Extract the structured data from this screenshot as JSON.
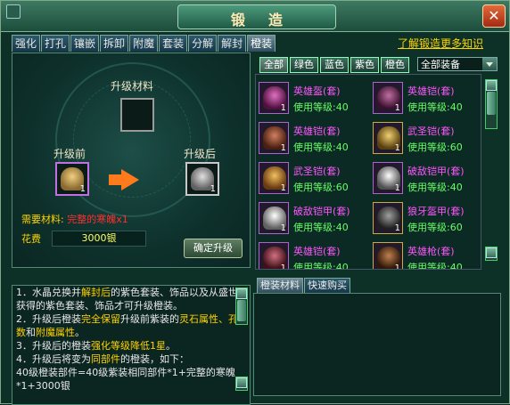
{
  "window": {
    "title": "锻造",
    "close_glyph": "✕"
  },
  "tabs": [
    {
      "label": "强化"
    },
    {
      "label": "打孔"
    },
    {
      "label": "镶嵌"
    },
    {
      "label": "拆卸"
    },
    {
      "label": "附魔"
    },
    {
      "label": "套装"
    },
    {
      "label": "分解"
    },
    {
      "label": "解封"
    },
    {
      "label": "橙装",
      "active": true
    }
  ],
  "help_link": "了解锻造更多知识",
  "upgrade": {
    "material_title": "升级材料",
    "before_label": "升级前",
    "after_label": "升级后",
    "before_qty": "1",
    "after_qty": "1",
    "need_label": "需要材料:",
    "need_value": "完整的寒魄x1",
    "cost_label": "花费",
    "cost_value": "3000银",
    "confirm_button": "确定升级"
  },
  "filters": {
    "tabs": [
      {
        "label": "全部",
        "active": true
      },
      {
        "label": "绿色"
      },
      {
        "label": "蓝色"
      },
      {
        "label": "紫色"
      },
      {
        "label": "橙色"
      }
    ],
    "select_value": "全部装备"
  },
  "items": [
    {
      "name": "英雄盔(套)",
      "level": "使用等级:40",
      "qty": "1",
      "color": "#b0308a",
      "frame": "purple"
    },
    {
      "name": "英雄铠(套)",
      "level": "使用等级:40",
      "qty": "1",
      "color": "#7a2a6a",
      "frame": "purple"
    },
    {
      "name": "英雄铠(套)",
      "level": "使用等级:40",
      "qty": "1",
      "color": "#8a4a30",
      "frame": "purple"
    },
    {
      "name": "武圣铠(套)",
      "level": "使用等级:60",
      "qty": "1",
      "color": "#8a6a20",
      "frame": "gold"
    },
    {
      "name": "武圣铠(套)",
      "level": "使用等级:60",
      "qty": "1",
      "color": "#c87a20",
      "frame": "purple"
    },
    {
      "name": "破敌铠甲(套)",
      "level": "使用等级:40",
      "qty": "1",
      "color": "#d8d8d8",
      "frame": "purple"
    },
    {
      "name": "破敌铠甲(套)",
      "level": "使用等级:40",
      "qty": "1",
      "color": "#e0e0e0",
      "frame": "purple"
    },
    {
      "name": "狼牙盔甲(套)",
      "level": "使用等级:60",
      "qty": "1",
      "color": "#5a5a5a",
      "frame": "gold"
    },
    {
      "name": "英雄铠(套)",
      "level": "使用等级:40",
      "qty": "1",
      "color": "#8a3a40",
      "frame": "purple"
    },
    {
      "name": "英雄枪(套)",
      "level": "使用等级:40",
      "qty": "1",
      "color": "#6a3a20",
      "frame": "gold"
    }
  ],
  "info_lines": [
    "1．水晶兑换并",
    "解封后",
    "的紫色套装、饰品以及从盛世获得的紫色套装、饰品才可升级橙装。",
    "2．升级后橙装",
    "完全保留",
    "升级前紫装的",
    "灵石属性、孔数",
    "和",
    "附魔属性",
    "。",
    "3．升级后的橙装",
    "强化等级降低1星",
    "。",
    "4．升级后将变为",
    "同部件",
    "的橙装，如下：",
    "40级橙装部件=40级紫装相同部件*1+完整的寒魄*1+3000银"
  ],
  "bottom_tabs": [
    {
      "label": "橙装材料",
      "active": true
    },
    {
      "label": "快速购买"
    }
  ],
  "colors": {
    "accent": "#ffd400",
    "item_name": "#ff55ff",
    "item_level": "#66ff66",
    "need_value": "#ff3030",
    "arrow": "#ff7a1a"
  }
}
